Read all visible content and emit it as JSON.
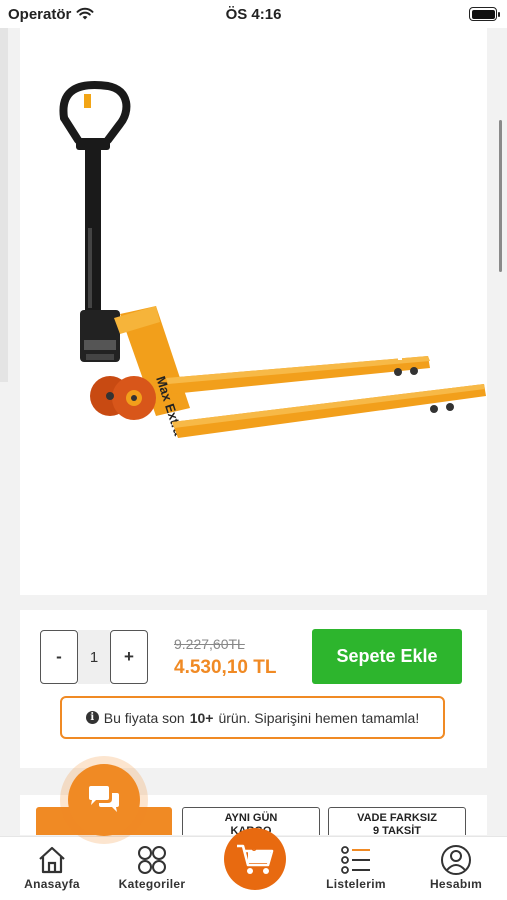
{
  "status_bar": {
    "carrier": "Operatör",
    "time": "ÖS 4:16"
  },
  "product": {
    "image_alt": "MaxExtra transpalet",
    "brand_text": "Max Extra"
  },
  "purchase": {
    "qty_minus": "-",
    "qty_value": "1",
    "qty_plus": "+",
    "old_price": "9.227,60TL",
    "new_price": "4.530,10 TL",
    "add_to_cart": "Sepete Ekle",
    "stock_notice": {
      "prefix": "Bu fiyata son",
      "count": "10+",
      "suffix": "ürün. Siparişini hemen tamamla!"
    }
  },
  "features": [
    {
      "line1": "İletişim",
      "line2": ""
    },
    {
      "line1": "AYNI GÜN",
      "line2": "KARGO"
    },
    {
      "line1": "VADE FARKSIZ",
      "line2": "9 TAKSİT"
    }
  ],
  "tab_bar": {
    "items": [
      {
        "label": "Anasayfa",
        "icon": "home-icon"
      },
      {
        "label": "Kategoriler",
        "icon": "grid-icon"
      },
      {
        "label": "",
        "icon": "cart-icon",
        "badge": "0"
      },
      {
        "label": "Listelerim",
        "icon": "list-icon"
      },
      {
        "label": "Hesabım",
        "icon": "account-icon"
      }
    ]
  },
  "colors": {
    "accent": "#f08a24",
    "cart": "#e86a10",
    "add_to_cart": "#2db52d"
  }
}
